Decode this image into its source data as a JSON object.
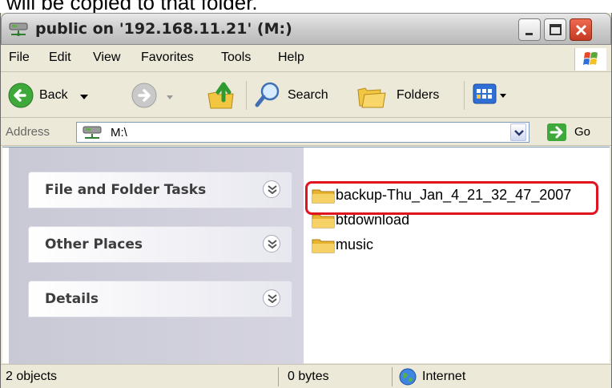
{
  "caption": "will be copied to that folder.",
  "window": {
    "title": "public on '192.168.11.21' (M:)"
  },
  "menu": [
    "File",
    "Edit",
    "View",
    "Favorites",
    "Tools",
    "Help"
  ],
  "toolbar": {
    "back_label": "Back",
    "search_label": "Search",
    "folders_label": "Folders"
  },
  "address": {
    "label": "Address",
    "value": "M:\\",
    "go_label": "Go"
  },
  "tasks": [
    {
      "title": "File and Folder Tasks"
    },
    {
      "title": "Other Places"
    },
    {
      "title": "Details"
    }
  ],
  "files": [
    {
      "name": "backup-Thu_Jan_4_21_32_47_2007",
      "icon": "folder-icon"
    },
    {
      "name": "btdownload",
      "icon": "folder-icon"
    },
    {
      "name": "music",
      "icon": "folder-icon"
    }
  ],
  "status": {
    "objects": "2 objects",
    "size": "0 bytes",
    "zone": "Internet"
  },
  "colors": {
    "highlight": "#e0141e",
    "close_button": "#d9482e",
    "folder": "#f2c641"
  }
}
